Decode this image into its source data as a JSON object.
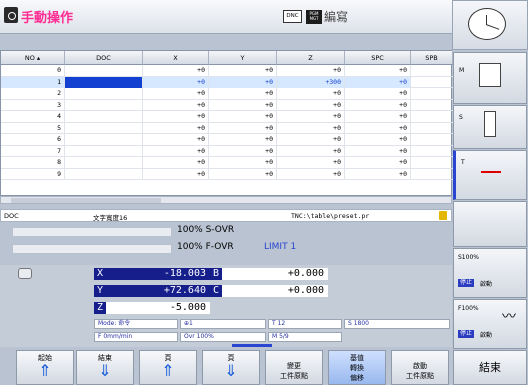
{
  "topbar": {
    "mode_title": "手動操作",
    "dnc_label": "DNC",
    "pgm_label_1": "PGM",
    "pgm_label_2": "MGT",
    "edit_title": "編寫"
  },
  "table": {
    "headers": [
      "NO",
      "DOC",
      "X",
      "Y",
      "Z",
      "SPC",
      "SPB"
    ],
    "rows": [
      {
        "no": "0",
        "doc": "",
        "x": "+0",
        "y": "+0",
        "z": "+0",
        "spc": "+0"
      },
      {
        "no": "1",
        "doc": "",
        "x": "+0",
        "y": "+0",
        "z": "+300",
        "spc": "+0"
      },
      {
        "no": "2",
        "doc": "",
        "x": "+0",
        "y": "+0",
        "z": "+0",
        "spc": "+0"
      },
      {
        "no": "3",
        "doc": "",
        "x": "+0",
        "y": "+0",
        "z": "+0",
        "spc": "+0"
      },
      {
        "no": "4",
        "doc": "",
        "x": "+0",
        "y": "+0",
        "z": "+0",
        "spc": "+0"
      },
      {
        "no": "5",
        "doc": "",
        "x": "+0",
        "y": "+0",
        "z": "+0",
        "spc": "+0"
      },
      {
        "no": "6",
        "doc": "",
        "x": "+0",
        "y": "+0",
        "z": "+0",
        "spc": "+0"
      },
      {
        "no": "7",
        "doc": "",
        "x": "+0",
        "y": "+0",
        "z": "+0",
        "spc": "+0"
      },
      {
        "no": "8",
        "doc": "",
        "x": "+0",
        "y": "+0",
        "z": "+0",
        "spc": "+0"
      },
      {
        "no": "9",
        "doc": "",
        "x": "+0",
        "y": "+0",
        "z": "+0",
        "spc": "+0"
      }
    ]
  },
  "status": {
    "field": "DOC",
    "width": "文字寬度16",
    "path": "TNC:\\table\\preset.pr"
  },
  "override": {
    "s_ovr": "100% S-OVR",
    "f_ovr": "100% F-OVR",
    "limit": "LIMIT 1"
  },
  "positions": {
    "x_label": "X",
    "x_value": "-18.003",
    "b_label": "B",
    "b_value": "+0.000",
    "y_label": "Y",
    "y_value": "+72.640",
    "c_label": "C",
    "c_value": "+0.000",
    "z_label": "Z",
    "z_value": "-5.000"
  },
  "status_fields": {
    "mode": "Mode: 命令",
    "tool_num": "1",
    "tool": "T 12",
    "spindle": "S 1800",
    "feed": "F 0mm/min",
    "ovr": "Ovr 100%",
    "m": "M 5/9"
  },
  "right_softkeys": {
    "m_label": "M",
    "s_label": "S",
    "t_label": "T",
    "s100": "S100%",
    "f100": "F100%",
    "stop1": "停止",
    "start1": "啟動",
    "stop2": "停止",
    "start2": "啟動"
  },
  "softkeys": {
    "begin": "起始",
    "end_key": "結束",
    "page_up": "頁",
    "page_dn": "頁",
    "change_1": "變更",
    "change_2": "工件原點",
    "base_1": "基值",
    "base_2": "轉換",
    "base_3": "偏移",
    "activate_1": "啟動",
    "activate_2": "工件原點",
    "finish": "結束"
  }
}
